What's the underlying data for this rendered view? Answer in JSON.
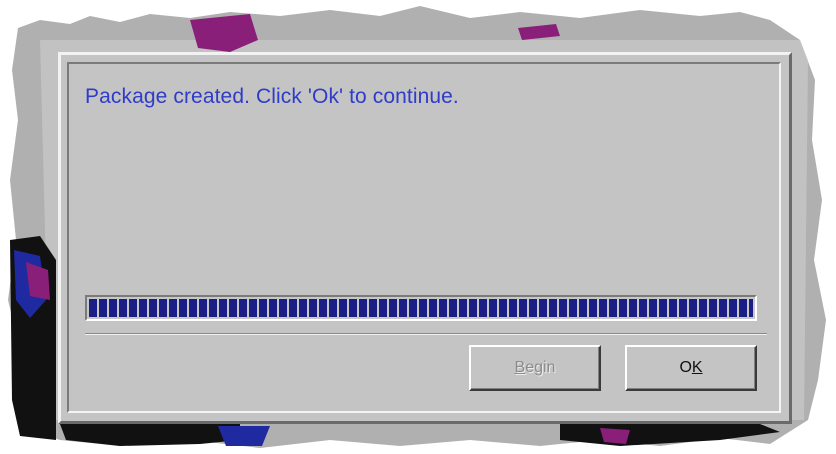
{
  "dialog": {
    "message": "Package created. Click 'Ok' to continue.",
    "progress_fraction": 1.0
  },
  "buttons": {
    "begin": {
      "prefix": "",
      "mnemonic": "B",
      "suffix": "egin",
      "enabled": false
    },
    "ok": {
      "prefix": "O",
      "mnemonic": "K",
      "suffix": "",
      "enabled": true
    }
  },
  "colors": {
    "dialog_face": "#c4c4c4",
    "message_text": "#2f3cc9",
    "progress_block": "#1a1e86",
    "disabled_text": "#8c8c8c",
    "backdrop_purple": "#8a1f7a",
    "backdrop_blue": "#1f2aa0"
  }
}
